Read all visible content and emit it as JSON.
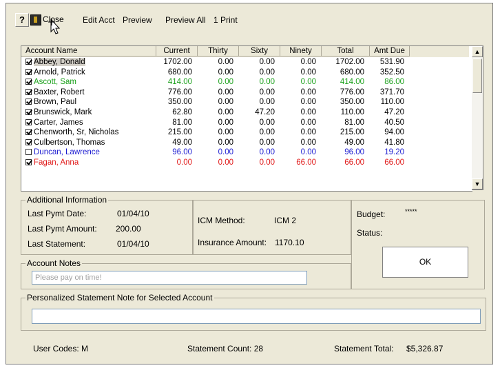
{
  "toolbar": {
    "help_label": "?",
    "close_label": "Close",
    "edit_acct_label": "Edit Acct",
    "preview_label": "Preview",
    "preview_all_label": "Preview All",
    "print_label": "1 Print"
  },
  "grid": {
    "columns": [
      "Account Name",
      "Current",
      "Thirty",
      "Sixty",
      "Ninety",
      "Total",
      "Amt Due"
    ],
    "rows": [
      {
        "checked": true,
        "name": "Abbey, Donald",
        "current": "1702.00",
        "thirty": "0.00",
        "sixty": "0.00",
        "ninety": "0.00",
        "total": "1702.00",
        "amt_due": "531.90",
        "color": "#000000"
      },
      {
        "checked": true,
        "name": "Arnold, Patrick",
        "current": "680.00",
        "thirty": "0.00",
        "sixty": "0.00",
        "ninety": "0.00",
        "total": "680.00",
        "amt_due": "352.50",
        "color": "#000000"
      },
      {
        "checked": true,
        "name": "Ascott, Sam",
        "current": "414.00",
        "thirty": "0.00",
        "sixty": "0.00",
        "ninety": "0.00",
        "total": "414.00",
        "amt_due": "86.00",
        "color": "#1aa01a"
      },
      {
        "checked": true,
        "name": "Baxter, Robert",
        "current": "776.00",
        "thirty": "0.00",
        "sixty": "0.00",
        "ninety": "0.00",
        "total": "776.00",
        "amt_due": "371.70",
        "color": "#000000"
      },
      {
        "checked": true,
        "name": "Brown, Paul",
        "current": "350.00",
        "thirty": "0.00",
        "sixty": "0.00",
        "ninety": "0.00",
        "total": "350.00",
        "amt_due": "110.00",
        "color": "#000000"
      },
      {
        "checked": true,
        "name": "Brunswick, Mark",
        "current": "62.80",
        "thirty": "0.00",
        "sixty": "47.20",
        "ninety": "0.00",
        "total": "110.00",
        "amt_due": "47.20",
        "color": "#000000"
      },
      {
        "checked": true,
        "name": "Carter, James",
        "current": "81.00",
        "thirty": "0.00",
        "sixty": "0.00",
        "ninety": "0.00",
        "total": "81.00",
        "amt_due": "40.50",
        "color": "#000000"
      },
      {
        "checked": true,
        "name": "Chenworth, Sr, Nicholas",
        "current": "215.00",
        "thirty": "0.00",
        "sixty": "0.00",
        "ninety": "0.00",
        "total": "215.00",
        "amt_due": "94.00",
        "color": "#000000"
      },
      {
        "checked": true,
        "name": "Culbertson, Thomas",
        "current": "49.00",
        "thirty": "0.00",
        "sixty": "0.00",
        "ninety": "0.00",
        "total": "49.00",
        "amt_due": "41.80",
        "color": "#000000"
      },
      {
        "checked": false,
        "name": "Duncan, Lawrence",
        "current": "96.00",
        "thirty": "0.00",
        "sixty": "0.00",
        "ninety": "0.00",
        "total": "96.00",
        "amt_due": "19.20",
        "color": "#1a1ad0"
      },
      {
        "checked": true,
        "name": "Fagan, Anna",
        "current": "0.00",
        "thirty": "0.00",
        "sixty": "0.00",
        "ninety": "66.00",
        "total": "66.00",
        "amt_due": "66.00",
        "color": "#e01818"
      }
    ]
  },
  "additional_info": {
    "title": "Additional Information",
    "last_pymt_date_label": "Last Pymt Date:",
    "last_pymt_date": "01/04/10",
    "last_pymt_amount_label": "Last Pymt Amount:",
    "last_pymt_amount": "200.00",
    "last_statement_label": "Last Statement:",
    "last_statement": "01/04/10",
    "icm_method_label": "ICM Method:",
    "icm_method": "ICM 2",
    "insurance_amount_label": "Insurance Amount:",
    "insurance_amount": "1170.10"
  },
  "side": {
    "budget_label": "Budget:",
    "budget_value": "*****",
    "status_label": "Status:",
    "ok_label": "OK"
  },
  "notes": {
    "title": "Account Notes",
    "placeholder": "Please pay on time!"
  },
  "statement_note": {
    "title": "Personalized Statement Note for Selected Account",
    "value": ""
  },
  "footer": {
    "user_codes": "User Codes:  M",
    "statement_count": "Statement Count: 28",
    "statement_total_label": "Statement Total:",
    "statement_total": "$5,326.87"
  }
}
